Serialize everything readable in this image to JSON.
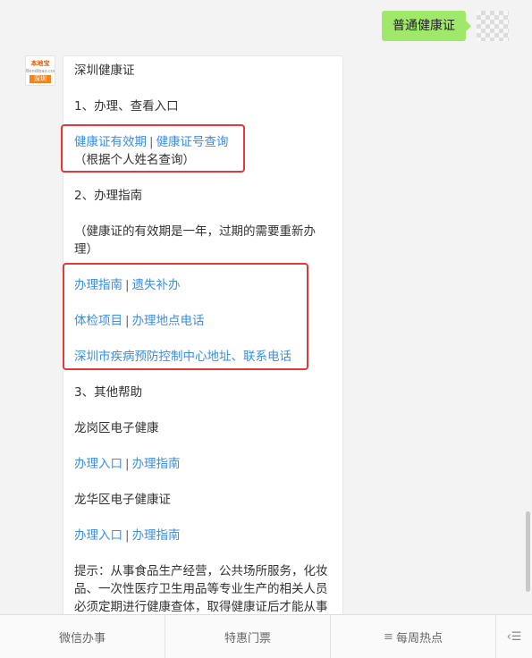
{
  "user_message": "普通健康证",
  "bot": {
    "avatar_line1": "本地宝",
    "avatar_line2": "Bendibao.com",
    "avatar_city": "深圳",
    "title": "深圳健康证",
    "s1_heading": "1、办理、查看入口",
    "s1_link1": "健康证有效期",
    "s1_link2": "健康证号查询",
    "s1_note": "（根据个人姓名查询）",
    "s2_heading": "2、办理指南",
    "s2_note": "（健康证的有效期是一年，过期的需要重新办理）",
    "s2_link1": "办理指南",
    "s2_link2": "遗失补办",
    "s2_link3": "体检项目",
    "s2_link4": "办理地点电话",
    "s2_link5": "深圳市疾病预防控制中心地址、联系电话",
    "s3_heading": "3、其他帮助",
    "longgang_title": "龙岗区电子健康",
    "longgang_link1": "办理入口",
    "longgang_link2": "办理指南",
    "longhua_title": "龙华区电子健康证",
    "longhua_link1": "办理入口",
    "longhua_link2": "办理指南",
    "tip": "提示：从事食品生产经营，公共场所服务，化妆品、一次性医疗卫生用品等专业生产的相关人员必须定期进行健康查体，取得健康证后才能从事",
    "separator": "|"
  },
  "menu": {
    "item1": "微信办事",
    "item2": "特惠门票",
    "item3": "每周热点",
    "item3_icon": "list-icon",
    "keyboard_icon": "keyboard-icon"
  }
}
